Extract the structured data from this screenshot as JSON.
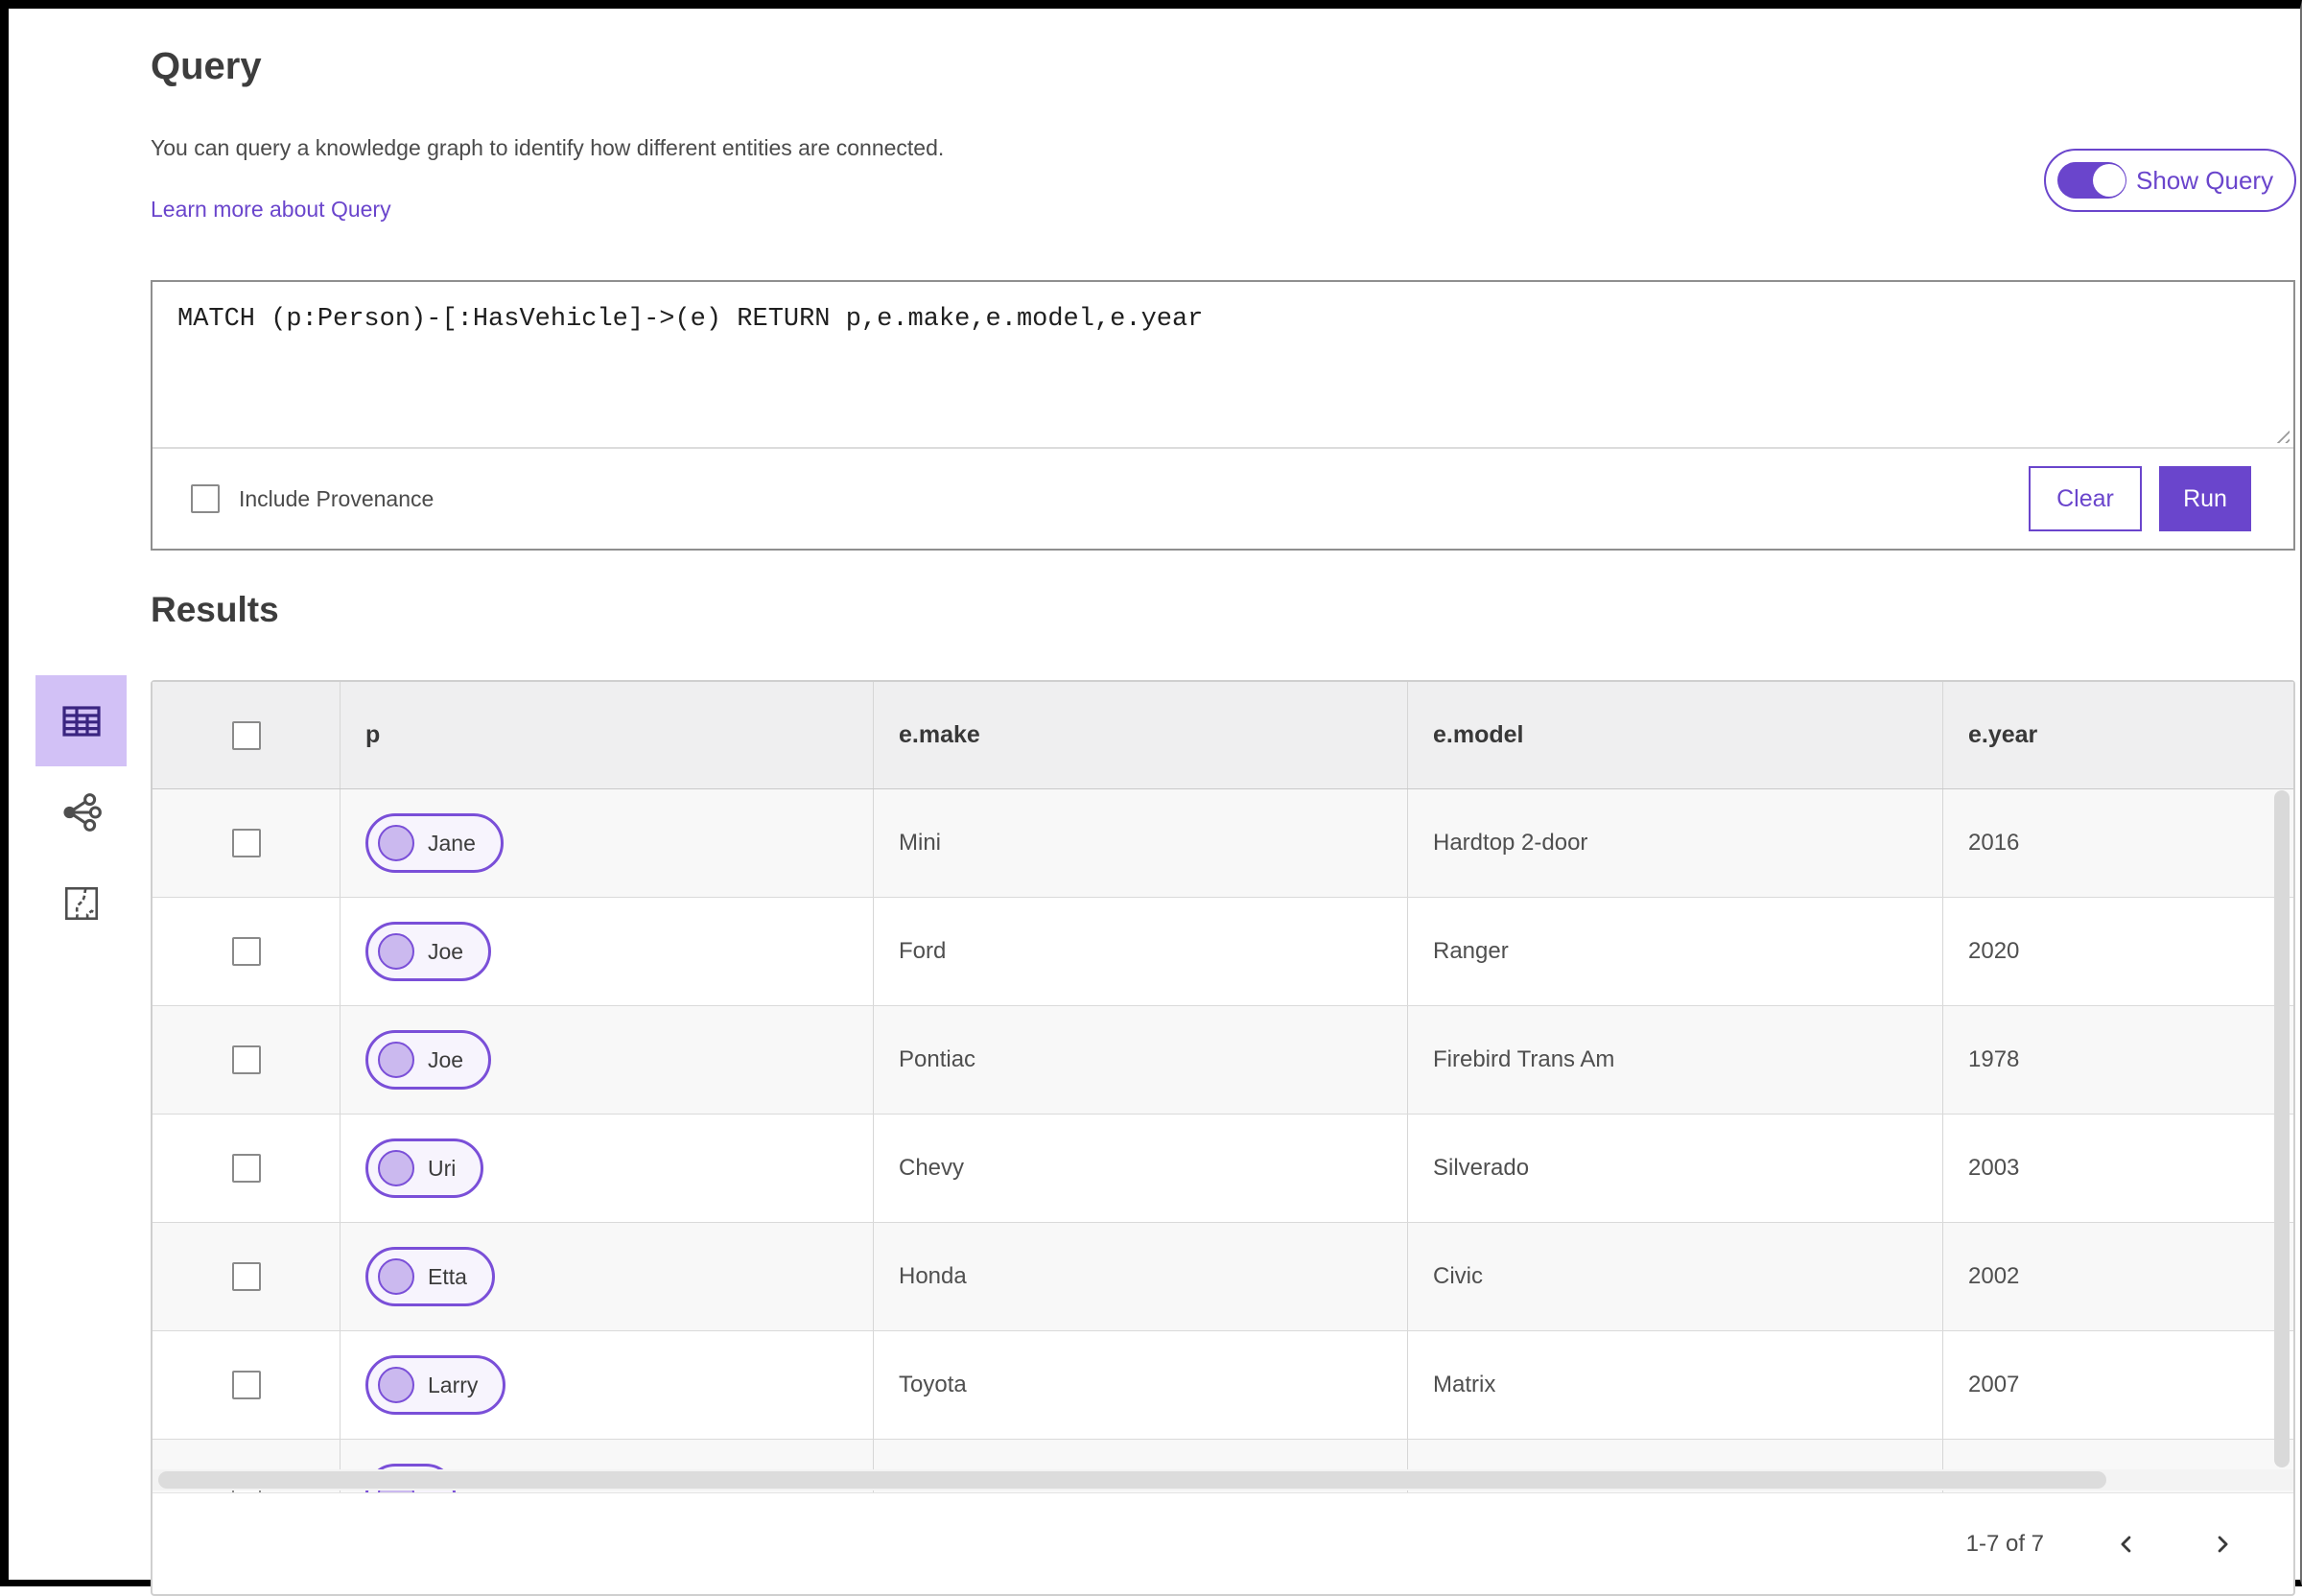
{
  "header": {
    "title": "Query",
    "description": "You can query a knowledge graph to identify how different entities are connected.",
    "learn_more_link": "Learn more about Query",
    "show_query_label": "Show Query",
    "show_query_state": "on"
  },
  "query_editor": {
    "query_text": "MATCH (p:Person)-[:HasVehicle]->(e) RETURN p,e.make,e.model,e.year",
    "include_provenance_label": "Include Provenance",
    "include_provenance_checked": false,
    "clear_button_label": "Clear",
    "run_button_label": "Run"
  },
  "results": {
    "heading": "Results",
    "view_switcher": {
      "selected": "table-view",
      "options": [
        "table-view",
        "link-chart-view",
        "map-view"
      ]
    },
    "table": {
      "columns": {
        "c0": "p",
        "c1": "e.make",
        "c2": "e.model",
        "c3": "e.year"
      },
      "rows": [
        {
          "p": "Jane",
          "e_make": "Mini",
          "e_model": "Hardtop 2-door",
          "e_year": "2016"
        },
        {
          "p": "Joe",
          "e_make": "Ford",
          "e_model": "Ranger",
          "e_year": "2020"
        },
        {
          "p": "Joe",
          "e_make": "Pontiac",
          "e_model": "Firebird Trans Am",
          "e_year": "1978"
        },
        {
          "p": "Uri",
          "e_make": "Chevy",
          "e_model": "Silverado",
          "e_year": "2003"
        },
        {
          "p": "Etta",
          "e_make": "Honda",
          "e_model": "Civic",
          "e_year": "2002"
        },
        {
          "p": "Larry",
          "e_make": "Toyota",
          "e_model": "Matrix",
          "e_year": "2007"
        },
        {
          "p": "",
          "e_make": "",
          "e_model": "",
          "e_year": ""
        }
      ]
    },
    "pagination": {
      "range_label": "1-7 of 7",
      "prev_icon": "chevron-left",
      "next_icon": "chevron-right"
    }
  },
  "colors": {
    "accent": "#6a45cc",
    "pill-border": "#7a4fd8",
    "pill-dot": "#cbb9ef",
    "selected-view-bg": "#d2c1f6",
    "table-header-bg": "#efeff0",
    "row-alt-bg": "#f8f8f8"
  }
}
